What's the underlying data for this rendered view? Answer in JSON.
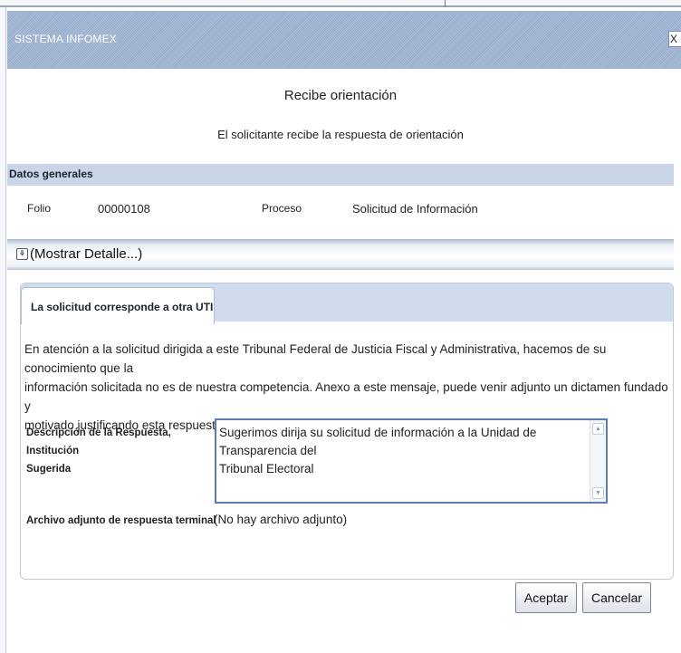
{
  "window": {
    "title": "SISTEMA INFOMEX",
    "close_label": "X"
  },
  "header": {
    "title": "Recibe orientación",
    "subtitle": "El solicitante recibe la respuesta de orientación"
  },
  "general": {
    "section_title": "Datos generales",
    "folio_label": "Folio",
    "folio_value": "00000108",
    "proceso_label": "Proceso",
    "proceso_value": "Solicitud de Información"
  },
  "detail_toggle": {
    "icon": "double-chevron-down-icon",
    "label": "(Mostrar Detalle...)"
  },
  "panel": {
    "tab_label": "La solicitud corresponde a otra UTI",
    "body_lines": [
      "En atención a la solicitud dirigida a este Tribunal Federal de Justicia Fiscal y Administrativa, hacemos de su conocimiento que la",
      "información solicitada no es de nuestra competencia. Anexo a este mensaje, puede venir adjunto un dictamen fundado y",
      "motivado justificando esta respuesta. Gracias por ejercer tu derecho a la información."
    ],
    "description_label_lines": [
      "Descripción de la Respuesta, Institución",
      "Sugerida"
    ],
    "description_value_lines": [
      "Sugerimos dirija su solicitud de información a la Unidad de Transparencia del",
      "Tribunal Electoral"
    ],
    "attachment_label": "Archivo adjunto de respuesta terminal",
    "attachment_value": "(No hay archivo adjunto)"
  },
  "buttons": {
    "accept": "Aceptar",
    "cancel": "Cancelar"
  }
}
